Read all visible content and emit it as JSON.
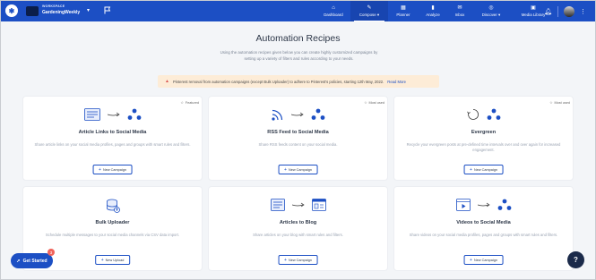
{
  "workspace": {
    "label": "WORKSPACE",
    "name": "GardeningWeekly"
  },
  "nav": [
    {
      "label": "Dashboard",
      "icon": "home-icon",
      "active": false
    },
    {
      "label": "Compose",
      "icon": "compose-icon",
      "active": true
    },
    {
      "label": "Planner",
      "icon": "calendar-icon",
      "active": false
    },
    {
      "label": "Analyze",
      "icon": "analytics-icon",
      "active": false
    },
    {
      "label": "Inbox",
      "icon": "inbox-icon",
      "active": false
    },
    {
      "label": "Discover",
      "icon": "discover-icon",
      "active": false
    },
    {
      "label": "Media Library",
      "icon": "media-icon",
      "active": false
    }
  ],
  "page": {
    "title": "Automation Recipes",
    "subtitle": "Using the automation recipes given below you can create highly customized campaigns by setting up a variety of filters and rules according to your needs."
  },
  "alert": {
    "text": "Pinterest removal from automation campaigns (except Bulk Uploader) to adhere to Pinterest's policies, starting 12th May, 2022.",
    "link": "Read More"
  },
  "cards": [
    {
      "title": "Article Links to Social Media",
      "desc": "Share article links on your social media profiles, pages and groups with smart rules and filters.",
      "button": "New Campaign",
      "badge": "Featured"
    },
    {
      "title": "RSS Feed to Social Media",
      "desc": "Share RSS feeds content on your social media.",
      "button": "New Campaign",
      "badge": "Most used"
    },
    {
      "title": "Evergreen",
      "desc": "Recycle your evergreen posts at pre-defined time intervals over and over again for increased engagement.",
      "button": "New Campaign",
      "badge": "Most used"
    },
    {
      "title": "Bulk Uploader",
      "desc": "Schedule multiple messages to your social media channels via CSV data import.",
      "button": "New Upload",
      "badge": ""
    },
    {
      "title": "Articles to Blog",
      "desc": "Share articles on your blog with smart rules and filters.",
      "button": "New Campaign",
      "badge": ""
    },
    {
      "title": "Videos to Social Media",
      "desc": "Share videos on your social media profiles, pages and groups with smart rules and filters.",
      "button": "New Campaign",
      "badge": ""
    }
  ],
  "get_started": {
    "label": "Get Started",
    "count": "3"
  },
  "help": {
    "label": "?"
  },
  "colors": {
    "primary": "#1c4fc4",
    "alert_bg": "#fdecd7",
    "page_bg": "#f3f5f8"
  }
}
